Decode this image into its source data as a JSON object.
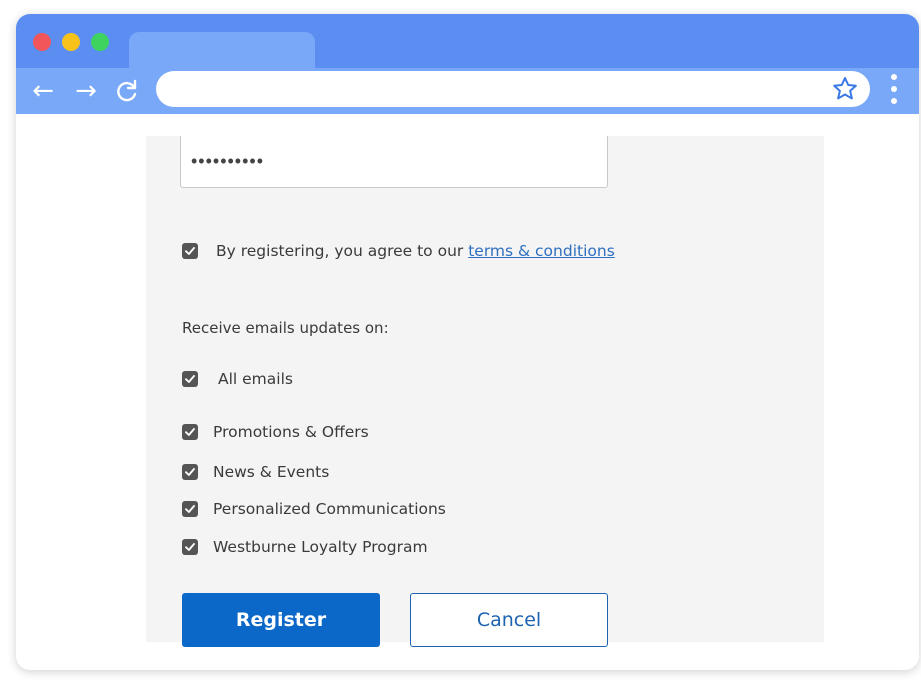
{
  "browser": {
    "address_value": "",
    "colors": {
      "titlebar": "#5b8ef0",
      "toolbar": "#78a8f7"
    },
    "icons": [
      "back-arrow-icon",
      "forward-arrow-icon",
      "reload-icon",
      "star-icon",
      "kebab-menu-icon"
    ]
  },
  "form": {
    "password_value": "••••••••••",
    "terms": {
      "checked": true,
      "text": "By registering, you agree to our ",
      "link_text": "terms & conditions"
    },
    "email_updates_heading": "Receive emails updates on:",
    "email_options": [
      {
        "label": "All emails",
        "checked": true
      },
      {
        "label": "Promotions & Offers",
        "checked": true
      },
      {
        "label": "News & Events",
        "checked": true
      },
      {
        "label": "Personalized Communications",
        "checked": true
      },
      {
        "label": "Westburne Loyalty Program",
        "checked": true
      }
    ],
    "register_label": "Register",
    "cancel_label": "Cancel",
    "colors": {
      "primary": "#0b68c8",
      "link": "#2f6fc0",
      "checkbox": "#555555"
    }
  }
}
